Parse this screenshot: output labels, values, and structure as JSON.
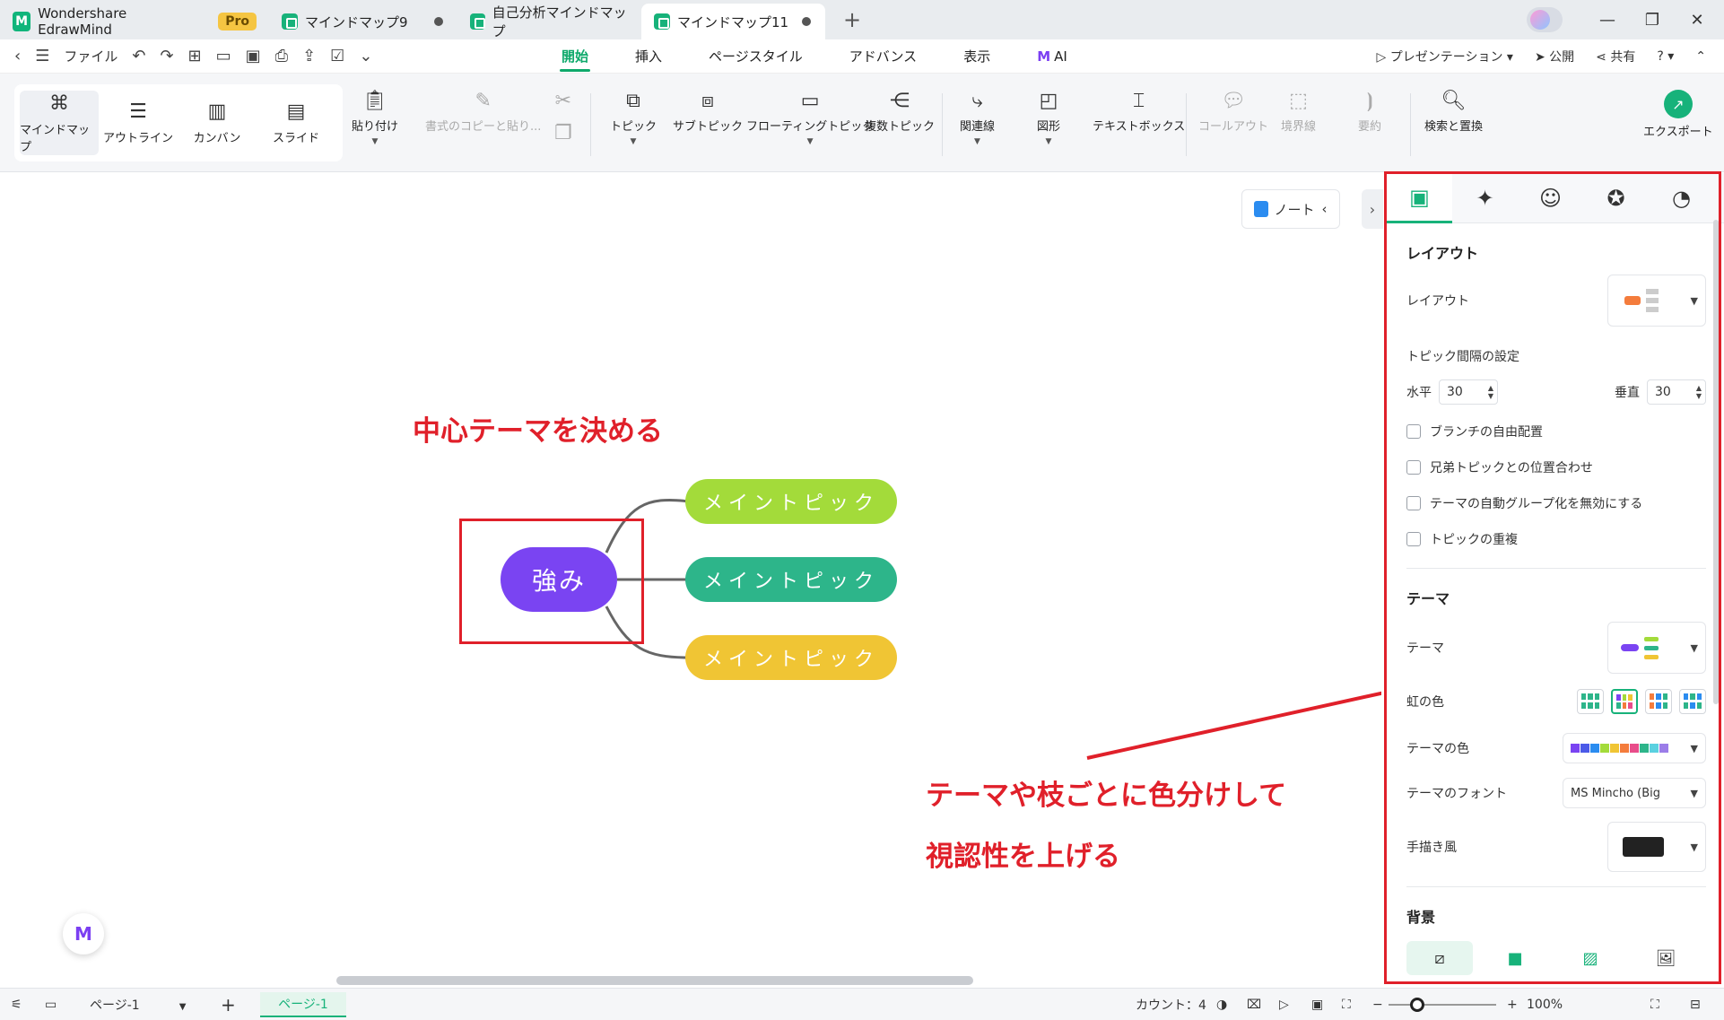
{
  "app": {
    "name": "Wondershare EdrawMind",
    "badge": "Pro"
  },
  "tabs": [
    {
      "label": "マインドマップ9"
    },
    {
      "label": "自己分析マインドマップ"
    },
    {
      "label": "マインドマップ11"
    }
  ],
  "menu": {
    "file": "ファイル",
    "tabs": [
      "開始",
      "挿入",
      "ページスタイル",
      "アドバンス",
      "表示",
      "AI"
    ],
    "right": {
      "present": "プレゼンテーション",
      "publish": "公開",
      "share": "共有"
    }
  },
  "ribbon": {
    "views": [
      "マインドマップ",
      "アウトライン",
      "カンバン",
      "スライド"
    ],
    "paste": "貼り付け",
    "format_copy": "書式のコピーと貼り...",
    "topic": "トピック",
    "subtopic": "サブトピック",
    "floating": "フローティングトピック",
    "multi": "複数トピック",
    "relation": "関連線",
    "shape": "図形",
    "textbox": "テキストボックス",
    "callout": "コールアウト",
    "boundary": "境界線",
    "summary": "要約",
    "find_replace": "検索と置換",
    "export": "エクスポート"
  },
  "canvas": {
    "note": "ノート",
    "central": "強み",
    "topics": [
      "メイントピック",
      "メイントピック",
      "メイントピック"
    ],
    "annotation1": "中心テーマを決める",
    "annotation2_line1": "テーマや枝ごとに色分けして",
    "annotation2_line2": "視認性を上げる",
    "colors": {
      "central": "#7a44f2",
      "t1": "#a3db3a",
      "t2": "#2db58a",
      "t3": "#f0c534",
      "annotation": "#e0202a"
    }
  },
  "panel": {
    "layout_title": "レイアウト",
    "layout_label": "レイアウト",
    "spacing_title": "トピック間隔の設定",
    "horizontal_label": "水平",
    "horizontal_value": "30",
    "vertical_label": "垂直",
    "vertical_value": "30",
    "checks": [
      "ブランチの自由配置",
      "兄弟トピックとの位置合わせ",
      "テーマの自動グループ化を無効にする",
      "トピックの重複"
    ],
    "theme_title": "テーマ",
    "theme_label": "テーマ",
    "rainbow_label": "虹の色",
    "theme_color_label": "テーマの色",
    "theme_font_label": "テーマのフォント",
    "theme_font_value": "MS Mincho (Big",
    "hand_drawn_label": "手描き風",
    "background_title": "背景"
  },
  "status": {
    "page_select": "ページ-1",
    "page_tab": "ページ-1",
    "count": "カウント：4",
    "zoom": "100%"
  }
}
